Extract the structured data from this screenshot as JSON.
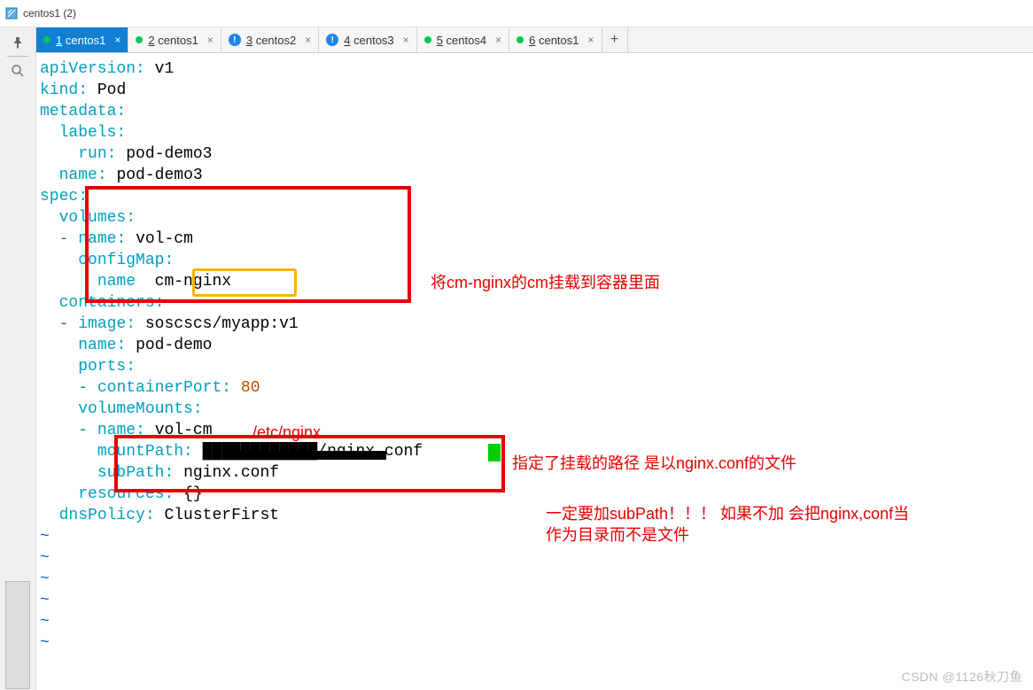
{
  "window": {
    "title": "centos1 (2)"
  },
  "tabs": [
    {
      "num": "1",
      "label": "centos1",
      "dot_color": "#00c853",
      "active": true,
      "icon": ""
    },
    {
      "num": "2",
      "label": "centos1",
      "dot_color": "#00c853",
      "active": false,
      "icon": ""
    },
    {
      "num": "3",
      "label": "centos2",
      "dot_color": "",
      "active": false,
      "icon": "alert"
    },
    {
      "num": "4",
      "label": "centos3",
      "dot_color": "",
      "active": false,
      "icon": "alert"
    },
    {
      "num": "5",
      "label": "centos4",
      "dot_color": "#00c853",
      "active": false,
      "icon": ""
    },
    {
      "num": "6",
      "label": "centos1",
      "dot_color": "#00c853",
      "active": false,
      "icon": ""
    }
  ],
  "new_tab_label": "+",
  "code": {
    "l1_key": "apiVersion",
    "l1_val": "v1",
    "l2_key": "kind",
    "l2_val": "Pod",
    "l3_key": "metadata",
    "l4_key": "labels",
    "l5_key": "run",
    "l5_val": "pod-demo3",
    "l6_key": "name",
    "l6_val": "pod-demo3",
    "l7_key": "spec",
    "l8_key": "volumes",
    "l9_key": "name",
    "l9_val": "vol-cm",
    "l10_key": "configMap",
    "l11_key": "name",
    "l11_val": "cm-nginx",
    "l12_key": "containers",
    "l13_key": "image",
    "l13_val": "soscscs/myapp:v1",
    "l14_key": "name",
    "l14_val": "pod-demo",
    "l15_key": "ports",
    "l16_key": "containerPort",
    "l16_val": "80",
    "l17_key": "volumeMounts",
    "l18_key": "name",
    "l18_val": "vol-cm",
    "l19_key": "mountPath",
    "l19_val_suffix": "/nginx.conf",
    "l20_key": "subPath",
    "l20_val": "nginx.conf",
    "l21_key": "resources",
    "l21_val": "{}",
    "l22_key": "dnsPolicy",
    "l22_val": "ClusterFirst",
    "tilde": "~"
  },
  "annotations": {
    "a1": "将cm-nginx的cm挂载到容器里面",
    "a2": "/etc/nginx",
    "a3": "指定了挂载的路径 是以nginx.conf的文件",
    "a4a": "一定要加subPath！！！  如果不加 会把nginx,conf当",
    "a4b": "作为目录而不是文件"
  },
  "watermark": "CSDN @1126秋刀鱼",
  "icons": {
    "pin": "📌",
    "search": "🔍",
    "close": "×",
    "alert": "!"
  }
}
